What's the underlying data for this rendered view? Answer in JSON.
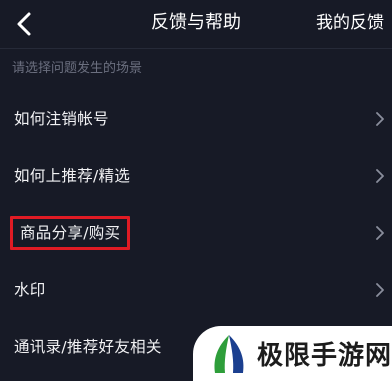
{
  "header": {
    "title": "反馈与帮助",
    "right_link": "我的反馈"
  },
  "section_hint": "请选择问题发生的场景",
  "items": [
    {
      "label": "如何注销帐号",
      "highlighted": false
    },
    {
      "label": "如何上推荐/精选",
      "highlighted": false
    },
    {
      "label": "商品分享/购买",
      "highlighted": true
    },
    {
      "label": "水印",
      "highlighted": false
    },
    {
      "label": "通讯录/推荐好友相关",
      "highlighted": false
    }
  ],
  "watermark": {
    "text": "极限手游网"
  },
  "colors": {
    "background": "#171a26",
    "highlight_border": "#e01b24",
    "hint_text": "#6b6f7f",
    "logo_green": "#2e9e3a",
    "logo_blue": "#1b3f8f"
  },
  "icons": {
    "back": "chevron-left-icon",
    "row_arrow": "chevron-right-icon",
    "watermark_logo": "leaf-logo-icon"
  }
}
